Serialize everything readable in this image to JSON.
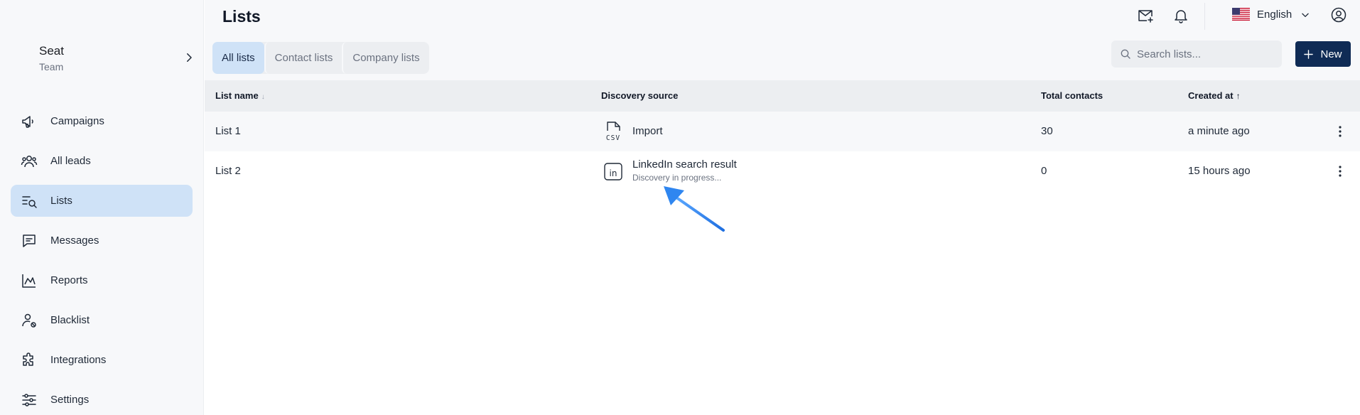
{
  "workspace": {
    "name": "Seat",
    "team": "Team"
  },
  "sidebar": {
    "items": [
      {
        "label": "Campaigns",
        "icon": "megaphone-icon",
        "active": false
      },
      {
        "label": "All leads",
        "icon": "users-icon",
        "active": false
      },
      {
        "label": "Lists",
        "icon": "list-search-icon",
        "active": true
      },
      {
        "label": "Messages",
        "icon": "chat-icon",
        "active": false
      },
      {
        "label": "Reports",
        "icon": "chart-icon",
        "active": false
      },
      {
        "label": "Blacklist",
        "icon": "user-blocked-icon",
        "active": false
      },
      {
        "label": "Integrations",
        "icon": "puzzle-icon",
        "active": false
      },
      {
        "label": "Settings",
        "icon": "sliders-icon",
        "active": false
      }
    ]
  },
  "header": {
    "title": "Lists",
    "language": "English",
    "icons": [
      "mail-plus-icon",
      "bell-icon",
      "us-flag-icon",
      "user-circle-icon"
    ]
  },
  "tabs": [
    {
      "label": "All lists",
      "active": true
    },
    {
      "label": "Contact lists",
      "active": false
    },
    {
      "label": "Company lists",
      "active": false
    }
  ],
  "search": {
    "placeholder": "Search lists...",
    "value": ""
  },
  "new_button": {
    "label": "New"
  },
  "table": {
    "columns": [
      "List name",
      "Discovery source",
      "Total contacts",
      "Created at"
    ],
    "rows": [
      {
        "name": "List 1",
        "source": "Import",
        "source_icon": "csv-file-icon",
        "source_status": "",
        "contacts": "30",
        "created": "a minute ago"
      },
      {
        "name": "List 2",
        "source": "LinkedIn search result",
        "source_icon": "linkedin-icon",
        "source_status": "Discovery in progress...",
        "contacts": "0",
        "created": "15 hours ago"
      }
    ]
  },
  "colors": {
    "accent": "#0f2b55",
    "active_bg": "#cfe2f7",
    "arrow": "#2f86f0",
    "sidebar_bg": "#f7f8fa"
  }
}
